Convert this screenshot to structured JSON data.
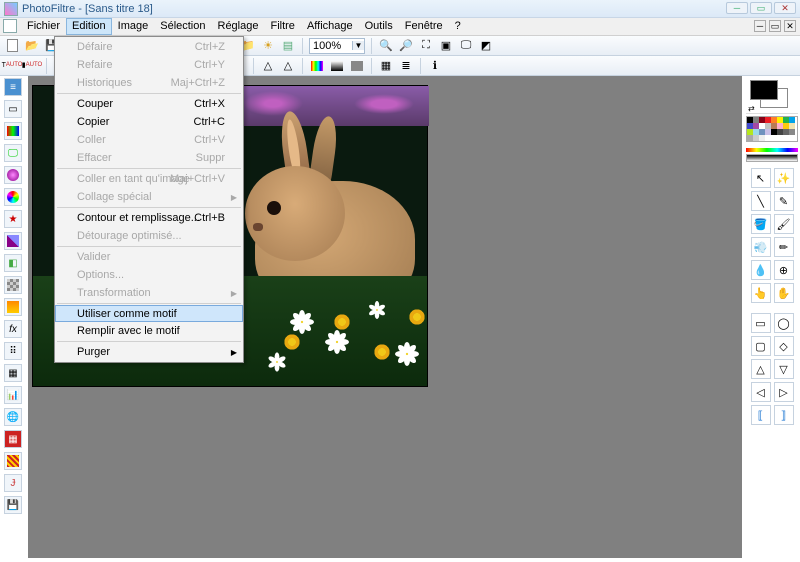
{
  "app": {
    "title": "PhotoFiltre - [Sans titre 18]"
  },
  "menubar": {
    "items": [
      "Fichier",
      "Edition",
      "Image",
      "Sélection",
      "Réglage",
      "Filtre",
      "Affichage",
      "Outils",
      "Fenêtre",
      "?"
    ],
    "activeIndex": 1
  },
  "toolbar1": {
    "zoom": "100%",
    "icons": [
      "new",
      "open",
      "save",
      "",
      "print",
      "scan",
      "",
      "undo",
      "redo",
      "",
      "img",
      "layer",
      "text",
      "",
      "folder",
      "tile",
      "grid",
      "",
      "zoomsel",
      "",
      "zoomin",
      "zoomout",
      "fit",
      "actual",
      "fullscreen",
      "crop"
    ]
  },
  "toolbar2": {
    "icons": [
      "t-auto",
      "rgb-auto",
      "",
      "balance",
      "",
      "flip-h",
      "flip-v",
      "rot-l",
      "rot-r",
      "",
      "dup",
      "tri",
      "drop",
      "drop2",
      "",
      "tri2",
      "tri3",
      "",
      "rgb",
      "grad",
      "grey",
      "",
      "grid",
      "layers",
      "",
      "info"
    ]
  },
  "leftTools": [
    "layers",
    "crop",
    "rgb",
    "screen",
    "sphere",
    "gradient",
    "star",
    "diag",
    "cube",
    "checker",
    "orange",
    "fx",
    "dots",
    "grid",
    "bars",
    "globe",
    "patch",
    "stripes",
    "cross",
    "save2"
  ],
  "rightTools": [
    "pointer",
    "wand",
    "pipette",
    "line",
    "fill",
    "brush",
    "spray",
    "pencil",
    "blur",
    "clone",
    "smudge",
    "hand",
    "",
    "",
    "rect",
    "ellipse",
    "rrect",
    "diamond",
    "triangle",
    "triangle2",
    "poly-l",
    "poly-r",
    "bracket-l",
    "bracket-r"
  ],
  "palette": [
    "#000",
    "#7f7f7f",
    "#880015",
    "#ed1c24",
    "#ff7f27",
    "#fff200",
    "#22b14c",
    "#00a2e8",
    "#3f48cc",
    "#a349a4",
    "#ffffff",
    "#c3c3c3",
    "#b97a57",
    "#ffaec9",
    "#ffc90e",
    "#efe4b0",
    "#b5e61d",
    "#99d9ea",
    "#7092be",
    "#c8bfe7",
    "#000",
    "#444",
    "#666",
    "#888",
    "#aaa",
    "#ccc",
    "#eee",
    "#fff"
  ],
  "editionMenu": {
    "items": [
      {
        "label": "Défaire",
        "shortcut": "Ctrl+Z",
        "disabled": true
      },
      {
        "label": "Refaire",
        "shortcut": "Ctrl+Y",
        "disabled": true
      },
      {
        "label": "Historiques",
        "shortcut": "Maj+Ctrl+Z",
        "disabled": true
      },
      {
        "sep": true
      },
      {
        "label": "Couper",
        "shortcut": "Ctrl+X",
        "disabled": false
      },
      {
        "label": "Copier",
        "shortcut": "Ctrl+C",
        "disabled": false
      },
      {
        "label": "Coller",
        "shortcut": "Ctrl+V",
        "disabled": true
      },
      {
        "label": "Effacer",
        "shortcut": "Suppr",
        "disabled": true
      },
      {
        "sep": true
      },
      {
        "label": "Coller en tant qu'image",
        "shortcut": "Maj+Ctrl+V",
        "disabled": true
      },
      {
        "label": "Collage spécial",
        "submenu": true,
        "disabled": true
      },
      {
        "sep": true
      },
      {
        "label": "Contour et remplissage...",
        "shortcut": "Ctrl+B",
        "disabled": false
      },
      {
        "label": "Détourage optimisé...",
        "disabled": true
      },
      {
        "sep": true
      },
      {
        "label": "Valider",
        "disabled": true
      },
      {
        "label": "Options...",
        "disabled": true
      },
      {
        "label": "Transformation",
        "submenu": true,
        "disabled": true
      },
      {
        "sep": true
      },
      {
        "label": "Utiliser comme motif",
        "highlight": true,
        "disabled": false
      },
      {
        "label": "Remplir avec le motif",
        "disabled": false
      },
      {
        "sep": true
      },
      {
        "label": "Purger",
        "submenu": true,
        "disabled": false
      }
    ]
  }
}
